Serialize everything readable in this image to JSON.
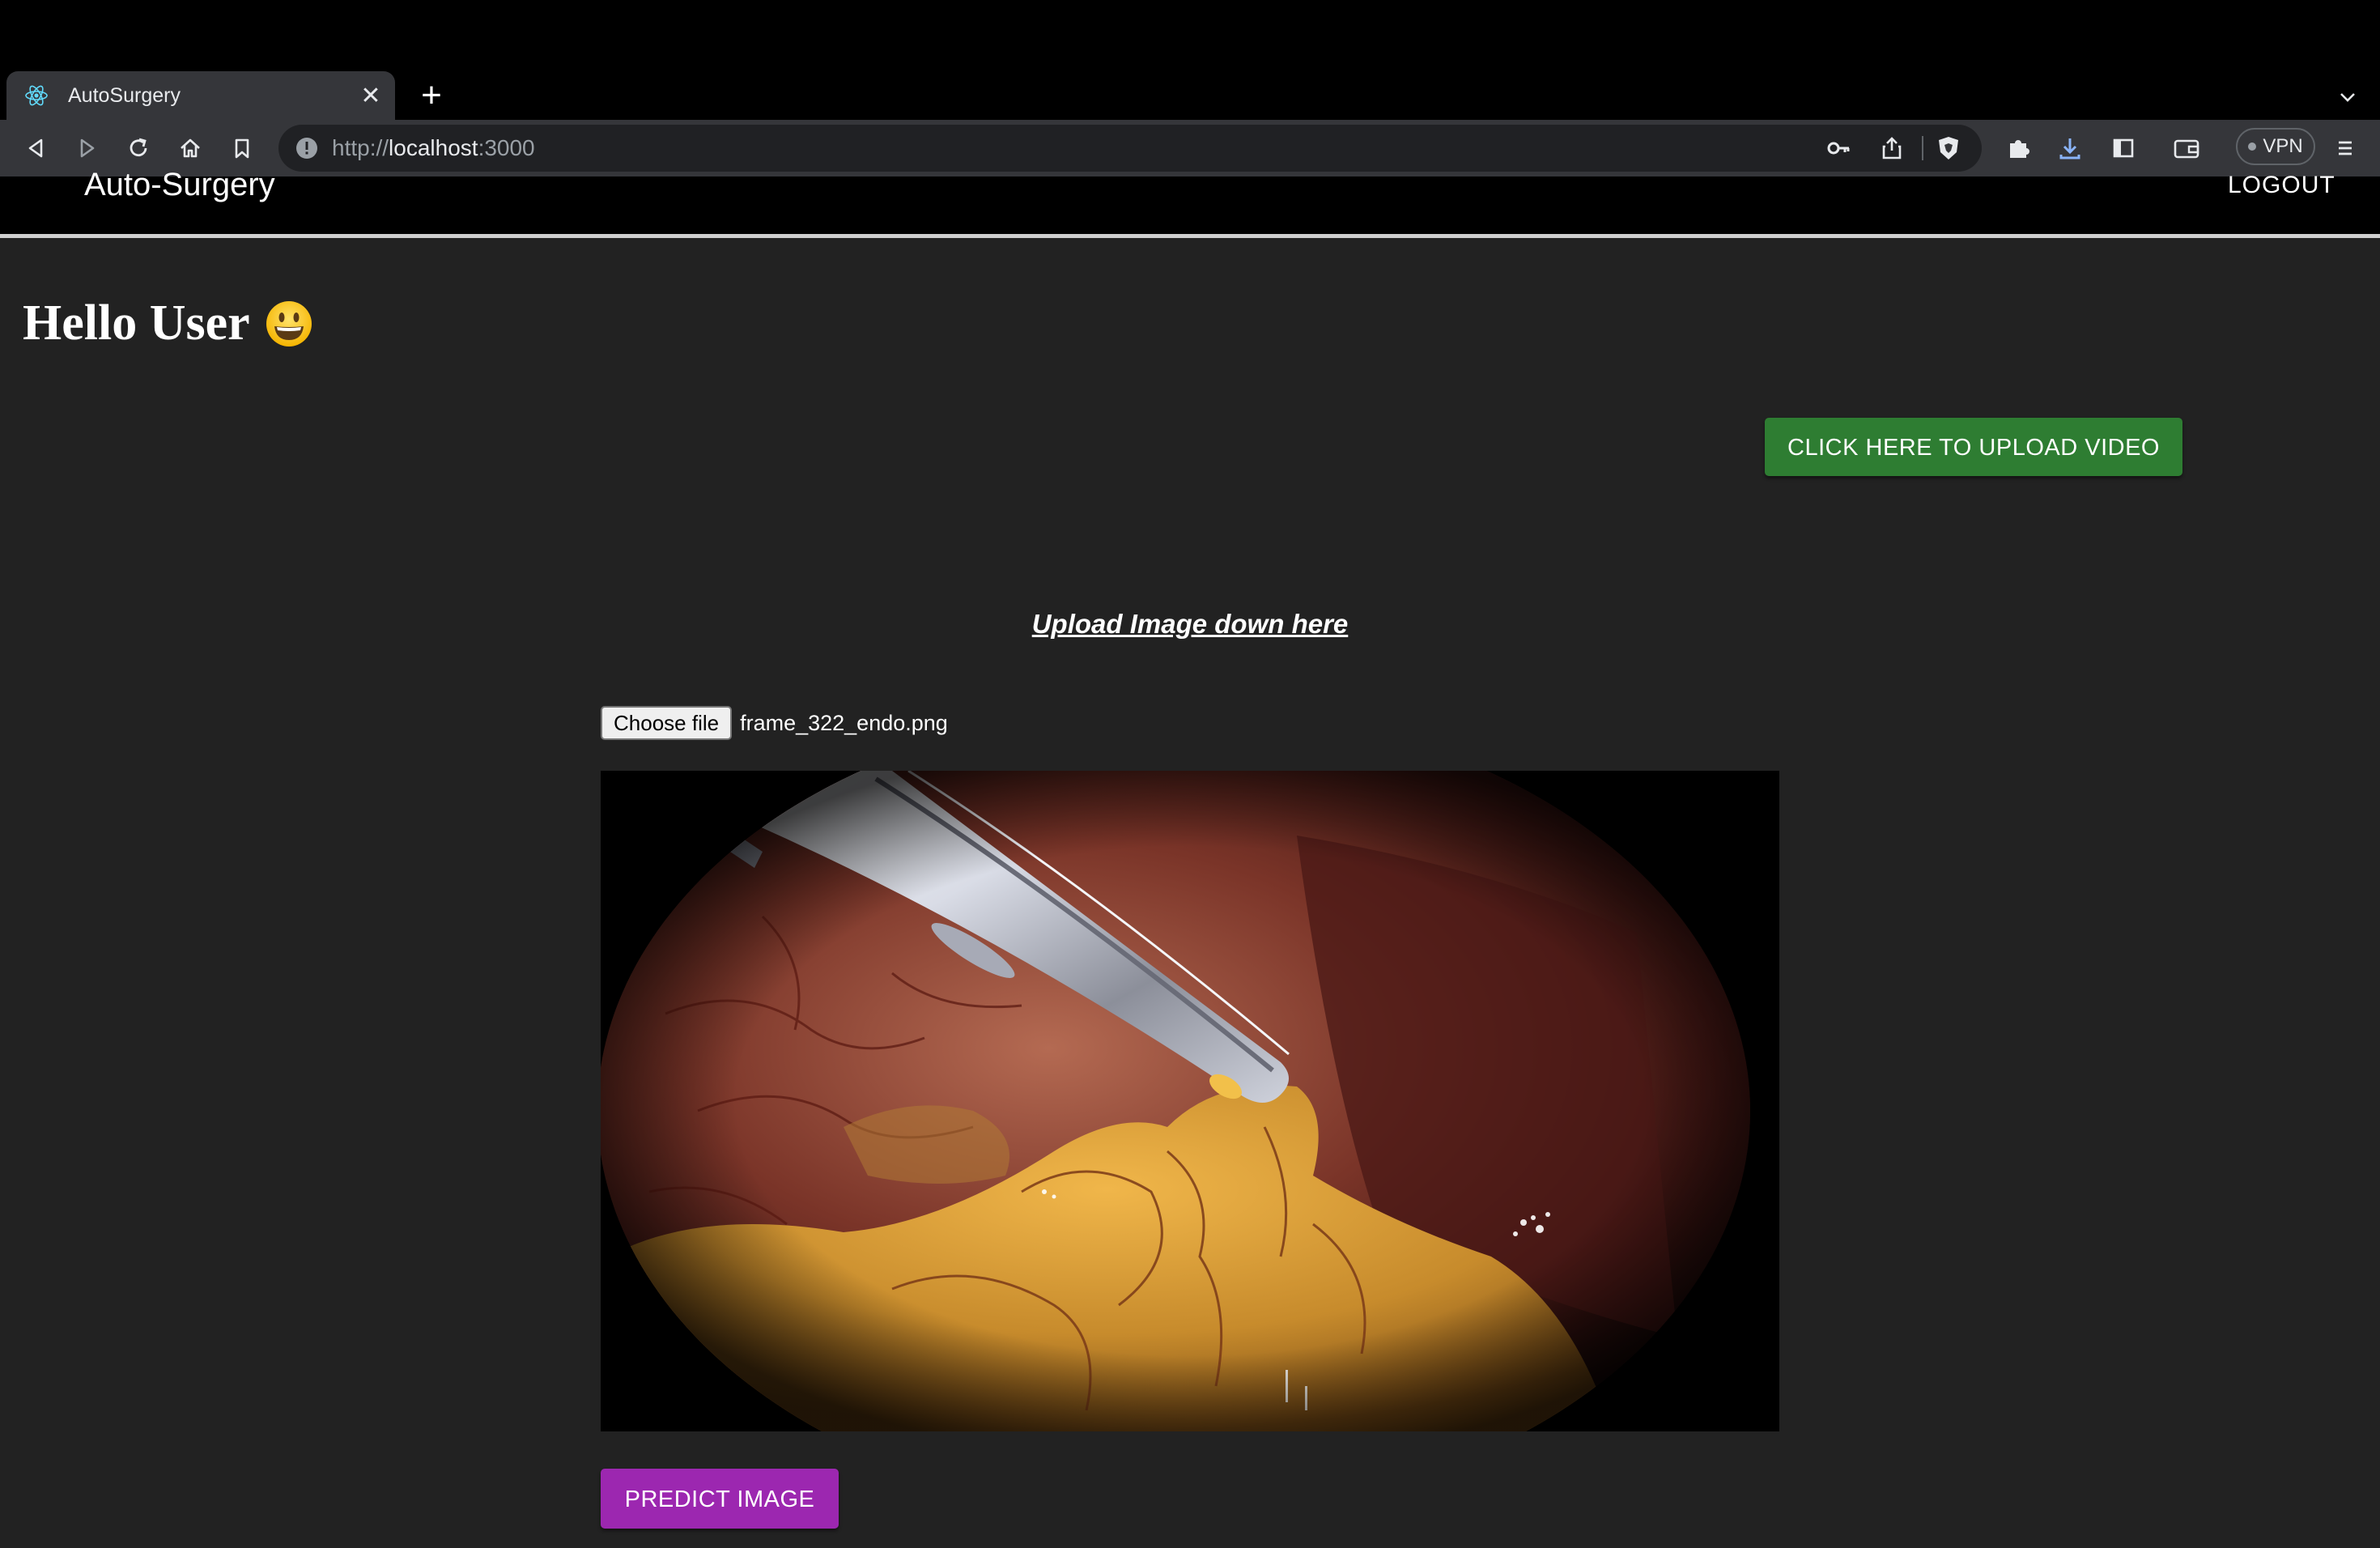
{
  "browser": {
    "tab": {
      "title": "AutoSurgery",
      "favicon": "react-icon"
    },
    "address_bar": {
      "scheme": "http://",
      "host": "localhost",
      "port": ":3000"
    },
    "vpn_label": "VPN"
  },
  "navbar": {
    "brand": "Auto-Surgery",
    "logout_label": "LOGOUT"
  },
  "main": {
    "greeting": "Hello User",
    "greeting_emoji": "grinning-face-icon",
    "upload_video_button": "CLICK HERE TO UPLOAD VIDEO",
    "upload_heading": "Upload Image down here",
    "file_input": {
      "button_label": "Choose file",
      "selected_file": "frame_322_endo.png"
    },
    "predict_button": "PREDICT IMAGE"
  },
  "colors": {
    "page_background": "#222222",
    "navbar_background": "#000000",
    "upload_video_button": "#2e7d32",
    "predict_button": "#9c27b0"
  }
}
